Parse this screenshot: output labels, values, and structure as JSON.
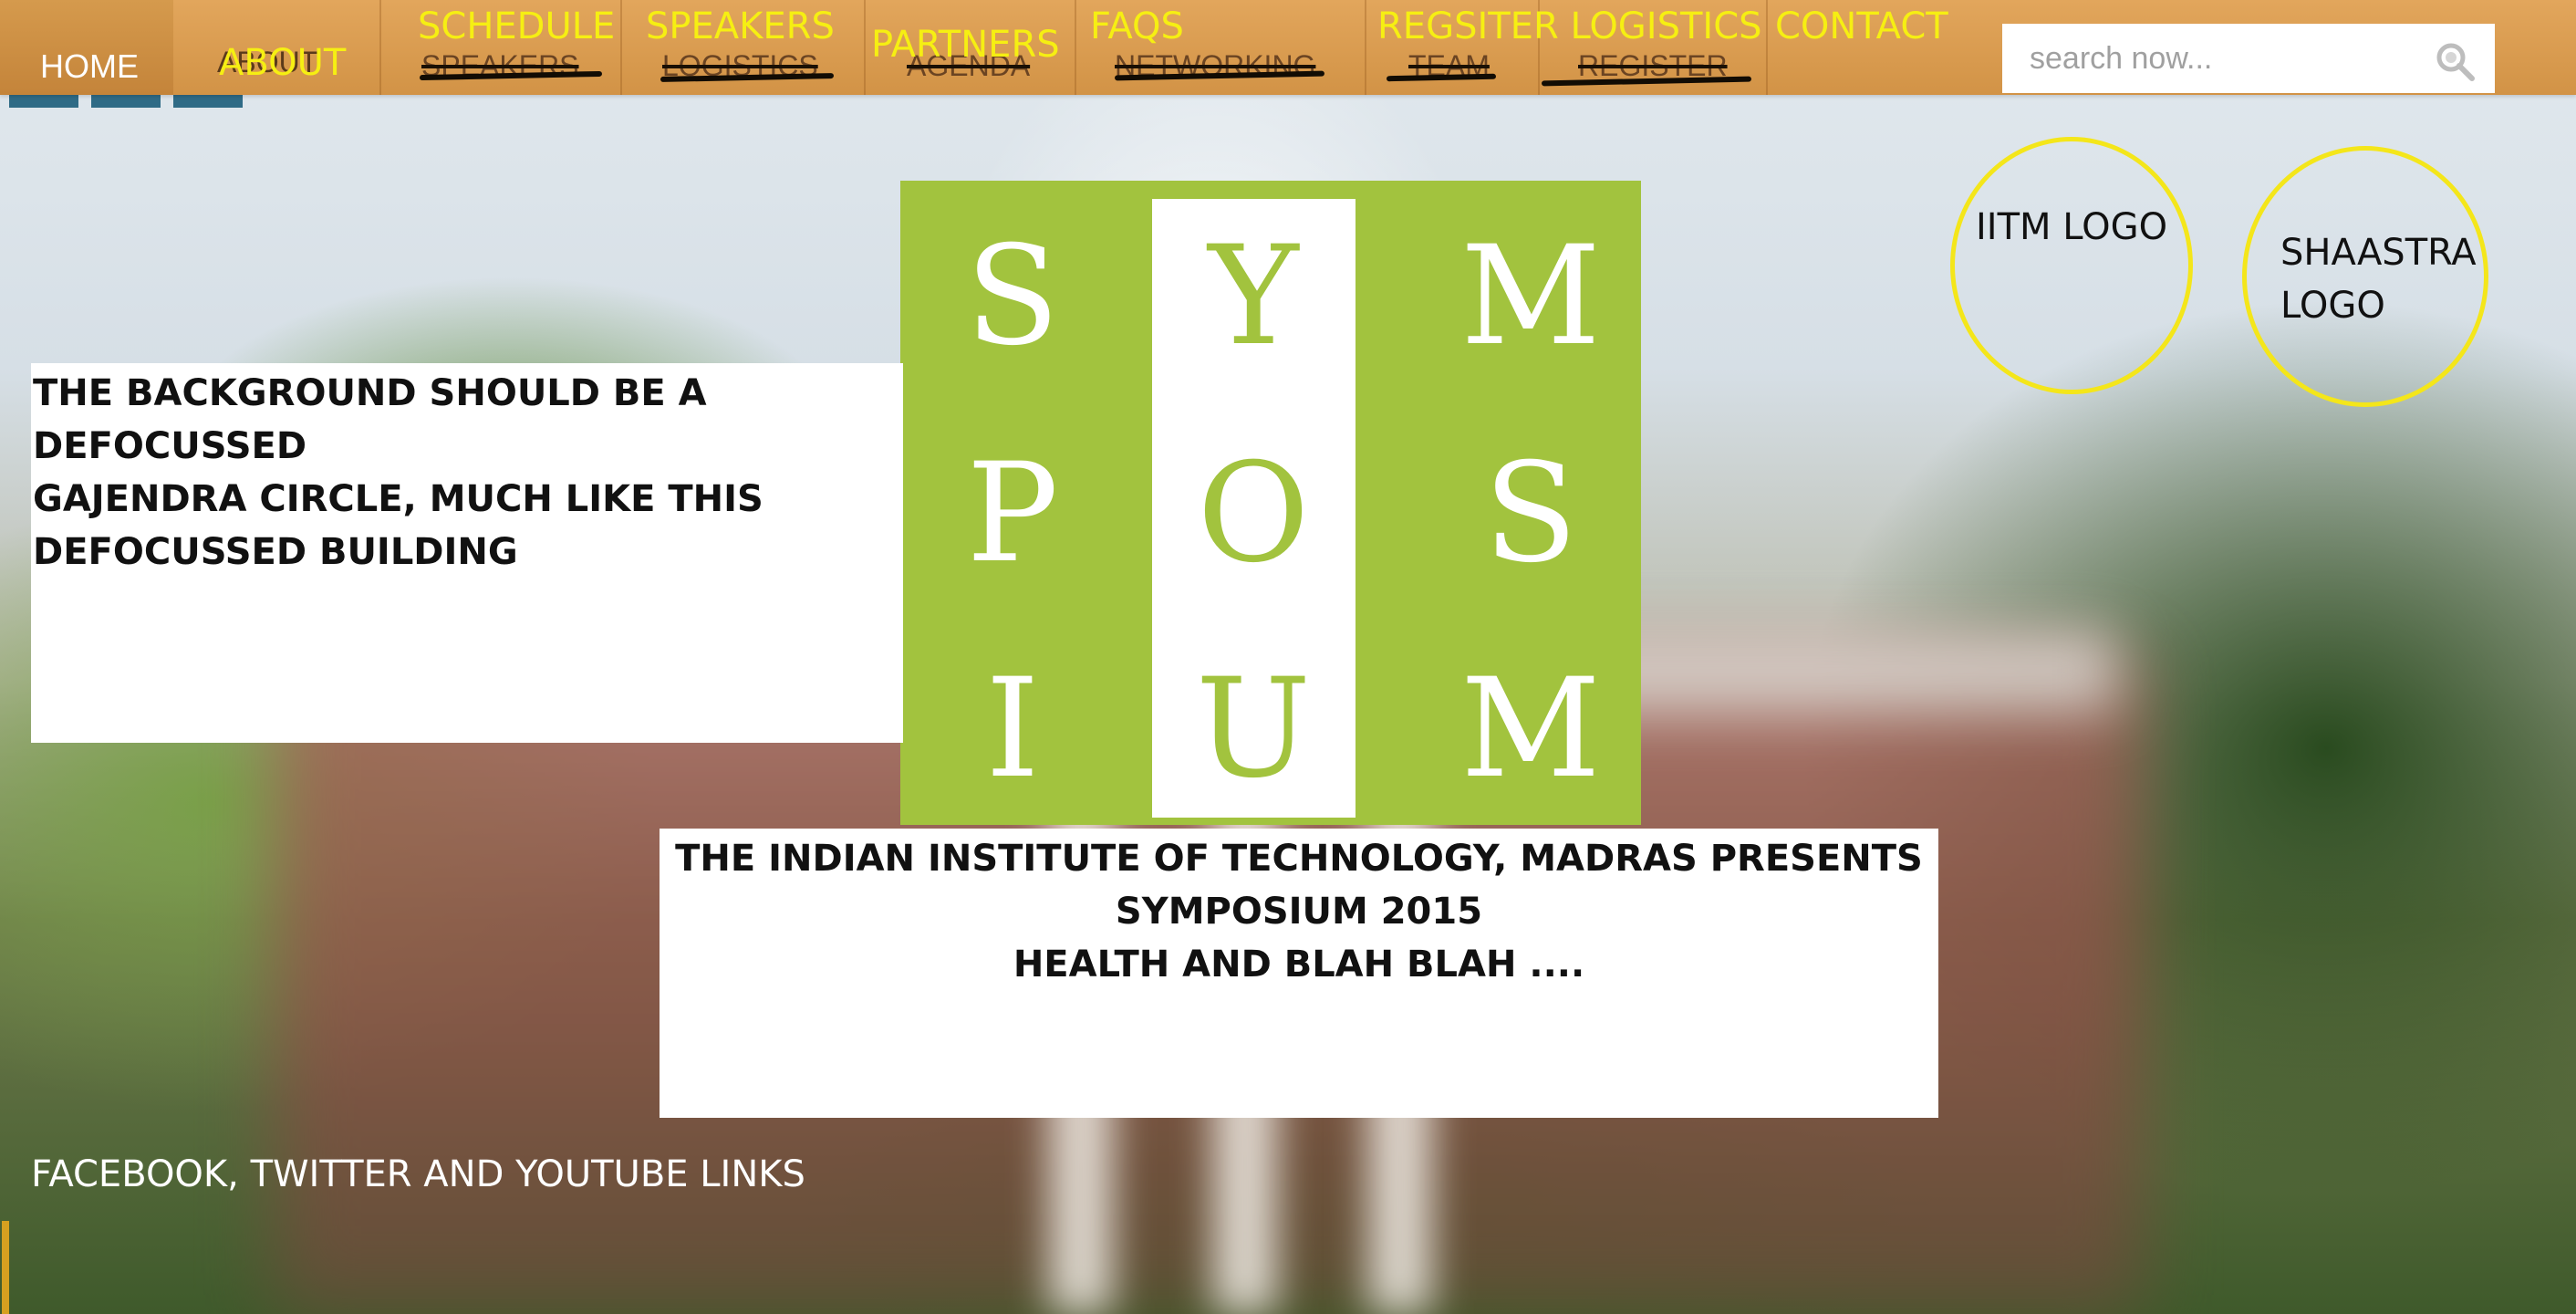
{
  "nav": {
    "home": "HOME",
    "about": "ABOUT",
    "items_struck": [
      "SPEAKERS",
      "LOGISTICS",
      "AGENDA",
      "NETWORKING",
      "TEAM",
      "REGISTER"
    ],
    "overlay_labels": [
      "SCHEDULE",
      "SPEAKERS",
      "PARTNERS",
      "FAQS",
      "REGSITER LOGISTICS",
      "CONTACT"
    ],
    "overlay_about": "ABOUT"
  },
  "search": {
    "placeholder": "search now...",
    "icon": "search-icon"
  },
  "logo": {
    "letters": [
      "S",
      "Y",
      "M",
      "P",
      "O",
      "S",
      "I",
      "U",
      "M"
    ],
    "color": "#a2c33e"
  },
  "notes": {
    "background_note_lines": [
      "THE BACKGROUND SHOULD BE A DEFOCUSSED",
      "GAJENDRA CIRCLE, MUCH LIKE THIS",
      "DEFOCUSSED BUILDING"
    ],
    "center_lines": [
      "THE INDIAN INSTITUTE OF TECHNOLOGY, MADRAS PRESENTS",
      "SYMPOSIUM 2015",
      "HEALTH AND BLAH BLAH ...."
    ]
  },
  "circles": {
    "iitm": "IITM LOGO",
    "shaastra_line1": "SHAASTRA",
    "shaastra_line2": "LOGO",
    "border_color": "#f4e61a"
  },
  "footer": {
    "social": "FACEBOOK, TWITTER AND YOUTUBE LINKS"
  },
  "colors": {
    "nav": "#d29346",
    "overlay_text": "#f6ef12"
  }
}
